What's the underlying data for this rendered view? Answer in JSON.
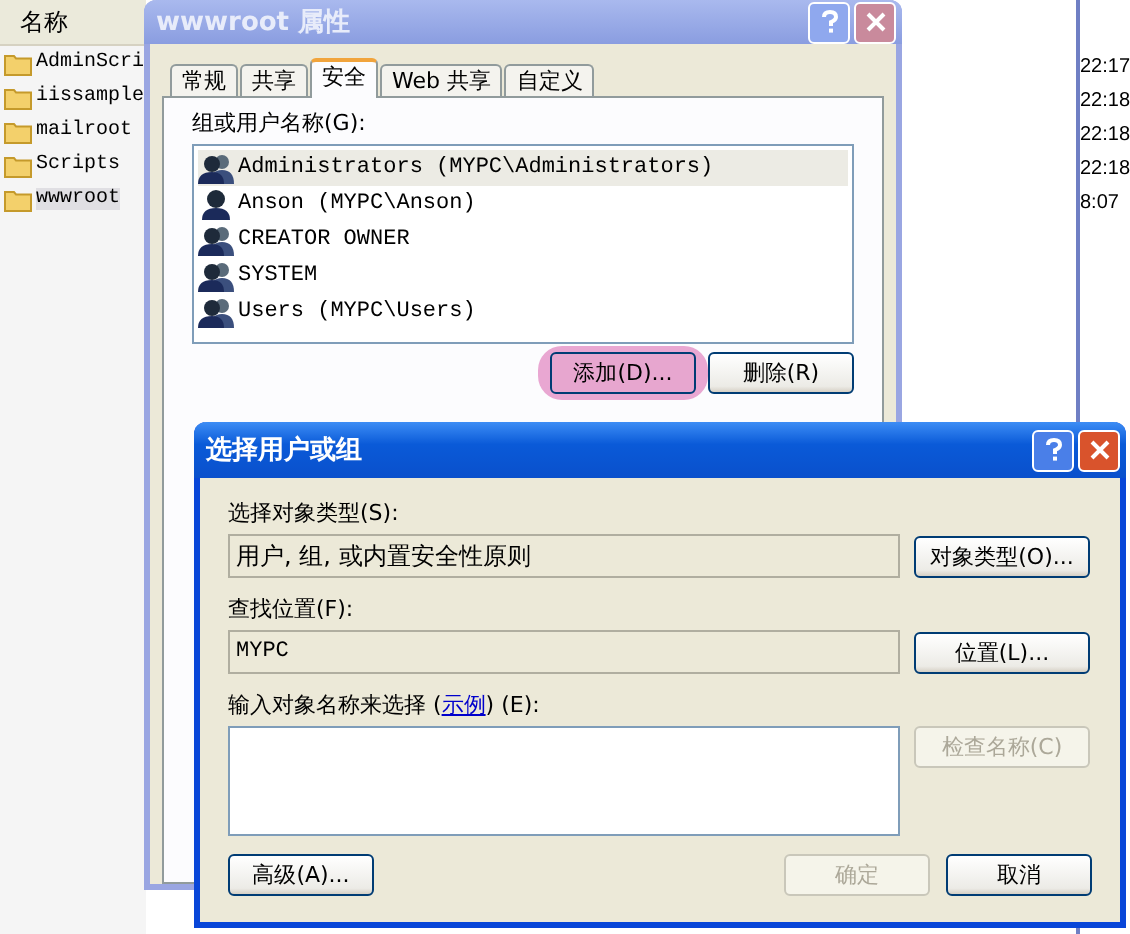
{
  "explorer": {
    "column_header": "名称",
    "files": [
      {
        "name": "AdminScri",
        "selected": false
      },
      {
        "name": "iissample",
        "selected": false
      },
      {
        "name": "mailroot",
        "selected": false
      },
      {
        "name": "Scripts",
        "selected": false
      },
      {
        "name": "wwwroot",
        "selected": true
      }
    ],
    "times": [
      "22:17",
      "22:18",
      "22:18",
      "22:18",
      "8:07"
    ]
  },
  "properties_window": {
    "title": "wwwroot 属性",
    "tabs": [
      {
        "label": "常规",
        "selected": false
      },
      {
        "label": "共享",
        "selected": false
      },
      {
        "label": "安全",
        "selected": true
      },
      {
        "label": "Web 共享",
        "selected": false
      },
      {
        "label": "自定义",
        "selected": false
      }
    ],
    "list_label": "组或用户名称(G):",
    "principals": [
      {
        "name": "Administrators (MYPC\\Administrators)",
        "kind": "group",
        "selected": true
      },
      {
        "name": "Anson (MYPC\\Anson)",
        "kind": "user",
        "selected": false
      },
      {
        "name": "CREATOR OWNER",
        "kind": "group",
        "selected": false
      },
      {
        "name": "SYSTEM",
        "kind": "group",
        "selected": false
      },
      {
        "name": "Users (MYPC\\Users)",
        "kind": "group",
        "selected": false
      }
    ],
    "buttons": [
      {
        "label": "添加(D)...",
        "highlighted": true
      },
      {
        "label": "删除(R)",
        "highlighted": false
      }
    ]
  },
  "select_dialog": {
    "title": "选择用户或组",
    "object_type_label": "选择对象类型(S):",
    "object_type_value": "用户, 组, 或内置安全性原则",
    "object_types_button": "对象类型(O)...",
    "location_label": "查找位置(F):",
    "location_value": "MYPC",
    "location_button": "位置(L)...",
    "names_label_before": "输入对象名称来选择 (",
    "example_link": "示例",
    "names_label_after": ") (E):",
    "check_names_button": {
      "label": "检查名称(C)",
      "disabled": true
    },
    "advanced_button": "高级(A)...",
    "ok_button": {
      "label": "确定",
      "disabled": true
    },
    "cancel_button": {
      "label": "取消",
      "disabled": false
    }
  }
}
